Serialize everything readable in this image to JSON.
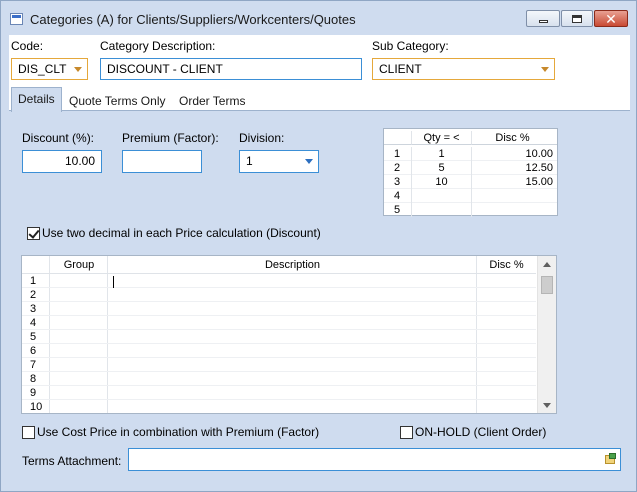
{
  "window": {
    "title": "Categories (A) for Clients/Suppliers/Workcenters/Quotes",
    "controls": {
      "minimize": "minimize-icon",
      "maximize": "maximize-icon",
      "close": "close-icon"
    }
  },
  "header": {
    "code_label": "Code:",
    "code_value": "DIS_CLT",
    "description_label": "Category Description:",
    "description_value": "DISCOUNT - CLIENT",
    "subcategory_label": "Sub Category:",
    "subcategory_value": "CLIENT"
  },
  "tabs": [
    {
      "label": "Details",
      "active": true
    },
    {
      "label": "Quote Terms Only",
      "active": false
    },
    {
      "label": "Order Terms",
      "active": false
    }
  ],
  "details": {
    "discount_label": "Discount (%):",
    "discount_value": "10.00",
    "premium_label": "Premium (Factor):",
    "premium_value": "",
    "division_label": "Division:",
    "division_value": "1",
    "two_decimal_label": "Use two decimal in each Price calculation (Discount)",
    "two_decimal_checked": true
  },
  "qty_grid": {
    "headers": [
      "",
      "Qty = <",
      "Disc %"
    ],
    "rows": [
      [
        "1",
        "1",
        "10.00"
      ],
      [
        "2",
        "5",
        "12.50"
      ],
      [
        "3",
        "10",
        "15.00"
      ],
      [
        "4",
        "",
        ""
      ],
      [
        "5",
        "",
        ""
      ]
    ]
  },
  "group_grid": {
    "headers": [
      "",
      "Group",
      "Description",
      "Disc %"
    ],
    "row_numbers": [
      "1",
      "2",
      "3",
      "4",
      "5",
      "6",
      "7",
      "8",
      "9",
      "10"
    ]
  },
  "footer": {
    "cost_price_label": "Use Cost Price in combination with Premium (Factor)",
    "cost_price_checked": false,
    "on_hold_label": "ON-HOLD  (Client Order)",
    "on_hold_checked": false,
    "terms_attachment_label": "Terms Attachment:",
    "terms_attachment_value": ""
  }
}
